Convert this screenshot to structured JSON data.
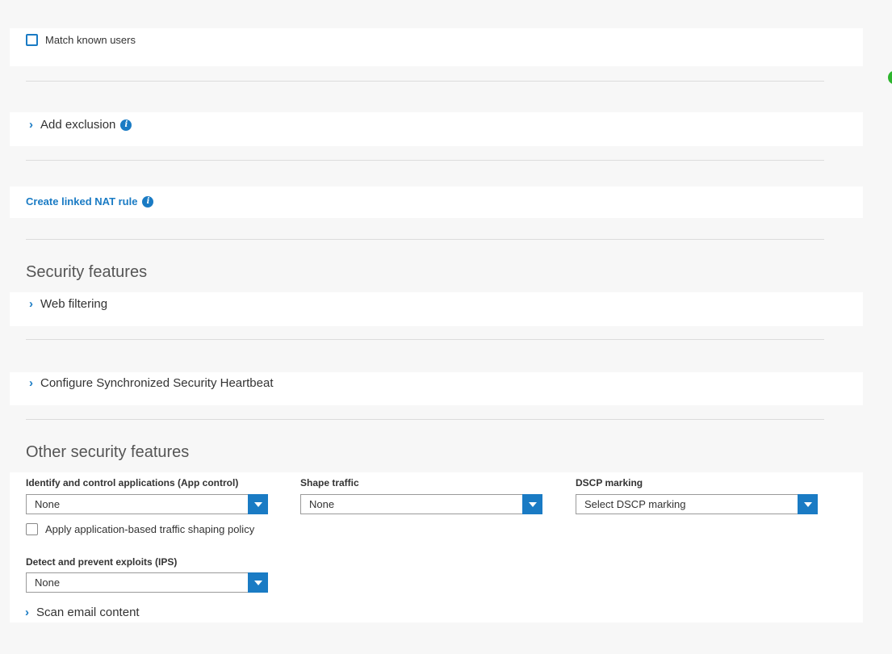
{
  "match_users": {
    "label": "Match known users",
    "checked": false
  },
  "add_exclusion": {
    "label": "Add exclusion"
  },
  "linked_nat": {
    "label": "Create linked NAT rule"
  },
  "security_features": {
    "heading": "Security features",
    "web_filtering": "Web filtering",
    "heartbeat": "Configure Synchronized Security Heartbeat"
  },
  "other_security": {
    "heading": "Other security features",
    "app_control": {
      "label": "Identify and control applications (App control)",
      "value": "None"
    },
    "shape_traffic": {
      "label": "Shape traffic",
      "value": "None"
    },
    "dscp": {
      "label": "DSCP marking",
      "value": "Select DSCP marking"
    },
    "app_shaping": {
      "label": "Apply application-based traffic shaping policy",
      "checked": false
    },
    "ips": {
      "label": "Detect and prevent exploits (IPS)",
      "value": "None"
    },
    "scan_email": "Scan email content"
  },
  "colors": {
    "accent": "#1a7bc4",
    "status_green": "#2db52d"
  }
}
